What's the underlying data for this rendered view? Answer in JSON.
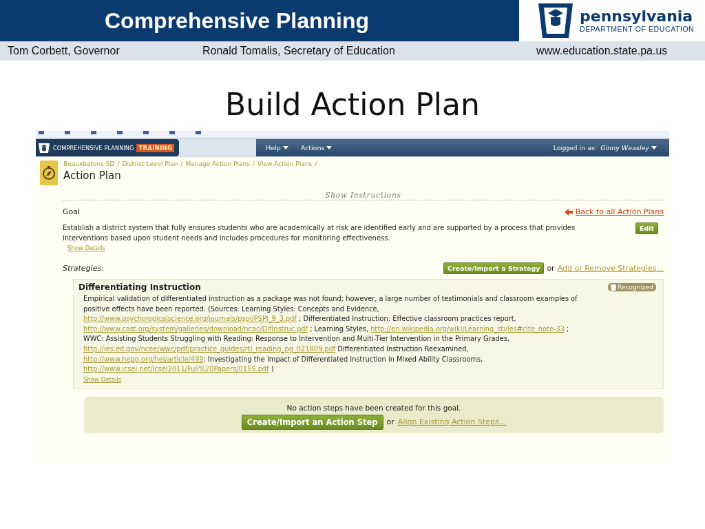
{
  "slide": {
    "header_title": "Comprehensive Planning",
    "logo": {
      "name": "pennsylvania",
      "subtitle": "DEPARTMENT OF EDUCATION"
    },
    "subheader": [
      "Tom Corbett, Governor",
      "Ronald Tomalis, Secretary of Education",
      "www.education.state.pa.us"
    ],
    "title": "Build Action Plan"
  },
  "app": {
    "brand": "COMPREHENSIVE PLANNING",
    "badge": "TRAINING",
    "menus": [
      {
        "label": "Help"
      },
      {
        "label": "Actions"
      }
    ],
    "user_label": "Logged in as:",
    "user_name": "Ginny Weasley",
    "breadcrumb": [
      {
        "label": "Beauxbatons SD",
        "separator": "/"
      },
      {
        "label": "District Level Plan",
        "separator": "/"
      },
      {
        "label": "Manage Action Plans",
        "separator": "/"
      },
      {
        "label": "View Action Plans",
        "separator": "/"
      }
    ],
    "page_title": "Action Plan",
    "show_instructions": "Show Instructions",
    "goal": {
      "label": "Goal",
      "back_link": "Back to all Action Plans",
      "text": "Establish a district system that fully ensures students who are academically at risk are identified early and are supported by a process that provides interventions based upon student needs and includes procedures for monitoring effectiveness.",
      "edit_button": "Edit",
      "show_details": "Show Details"
    },
    "strategies": {
      "label": "Strategies:",
      "create_button": "Create/Import a Strategy",
      "or": "or",
      "add_remove_link": "Add or Remove Strategies...",
      "items": [
        {
          "title": "Differentiating Instruction",
          "badge": "Recognized",
          "show_details": "Show Details",
          "lines": [
            [
              {
                "kind": "text",
                "text": "Empirical validation of differentiated instruction as a package was not found; however, a large number of testimonials and classroom examples of"
              }
            ],
            [
              {
                "kind": "text",
                "text": "positive effects have been reported. (Sources: Learning Styles: Concepts and Evidence,"
              }
            ],
            [
              {
                "kind": "link",
                "text": "http://www.psychologicalscience.org/journals/pspi/PSPI_9_3.pdf"
              },
              {
                "kind": "text",
                "text": " ; Differentiated Instruction: Effective classroom practices report,"
              }
            ],
            [
              {
                "kind": "link",
                "text": "http://www.cast.org/system/galleries/download/ncac/DifInstruc.pdf"
              },
              {
                "kind": "text",
                "text": " ; Learning Styles, "
              },
              {
                "kind": "link",
                "text": "http://en.wikipedia.org/wiki/Learning_styles#cite_note-33"
              },
              {
                "kind": "text",
                "text": " ;"
              }
            ],
            [
              {
                "kind": "text",
                "text": "WWC: Assisting Students Struggling with Reading: Response to Intervention and Multi-Tier Intervention in the Primary Grades,"
              }
            ],
            [
              {
                "kind": "link",
                "text": "http://ies.ed.gov/ncee/wwc/pdf/practice_guides/rti_reading_pg_021809.pdf"
              },
              {
                "kind": "text",
                "text": " Differentiated Instruction Reexamined,"
              }
            ],
            [
              {
                "kind": "link",
                "text": "http://www.hepg.org/hel/article/499"
              },
              {
                "kind": "text",
                "text": "; Investigating the Impact of Differentiated Instruction in Mixed Ability Classrooms,"
              }
            ],
            [
              {
                "kind": "link",
                "text": "http://www.icsei.net/icsei2011/Full%20Papers/0155.pdf"
              },
              {
                "kind": "text",
                "text": " )"
              }
            ]
          ]
        }
      ]
    },
    "action_steps": {
      "message": "No action steps have been created for this goal.",
      "create_button": "Create/Import an Action Step",
      "or": "or",
      "align_link": "Align Existing Action Steps..."
    }
  }
}
